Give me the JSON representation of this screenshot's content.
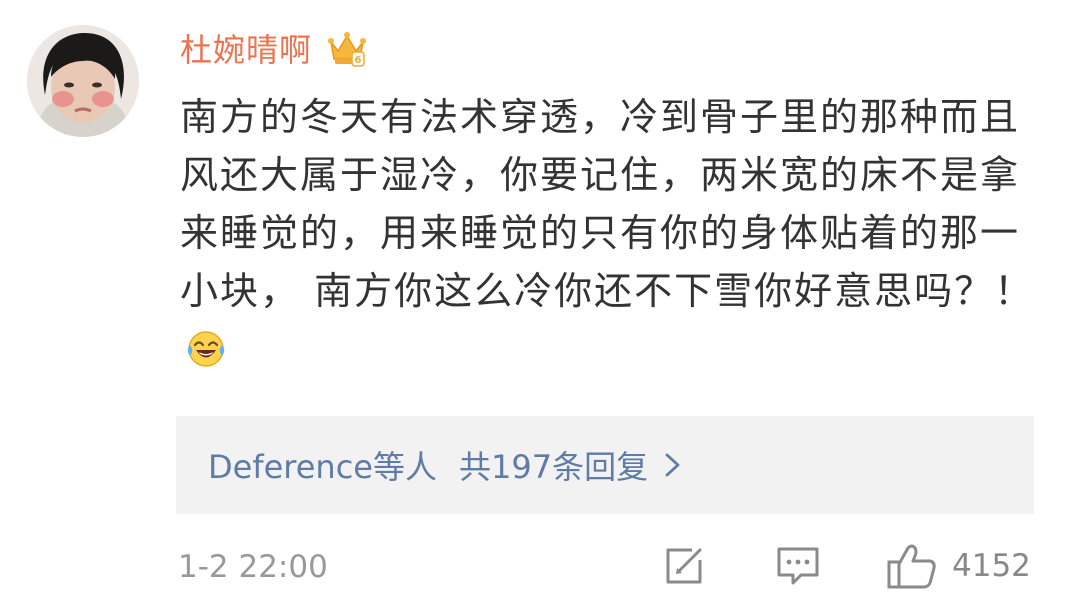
{
  "comment": {
    "username": "杜婉晴啊",
    "text": "南方的冬天有法术穿透，冷到骨子里的那种而且风还大属于湿冷，你要记住，两米宽的床不是拿来睡觉的，用来睡觉的只有你的身体贴着的那一小块， 南方你这么冷你还不下雪你好意思吗？！",
    "emoji": "laugh-cry-emoji",
    "timestamp": "1-2 22:00",
    "like_count": "4152"
  },
  "replies": {
    "names": "Deference等人",
    "count_label": "共197条回复"
  },
  "colors": {
    "username": "#eb7350",
    "link": "#5f7ba6",
    "meta": "#999999",
    "reply_bg": "#f2f2f2"
  },
  "icons": {
    "vip": "vip-crown-badge-icon",
    "repost": "repost-icon",
    "comment": "comment-icon",
    "like": "thumbs-up-icon",
    "chevron": "chevron-right-icon"
  }
}
